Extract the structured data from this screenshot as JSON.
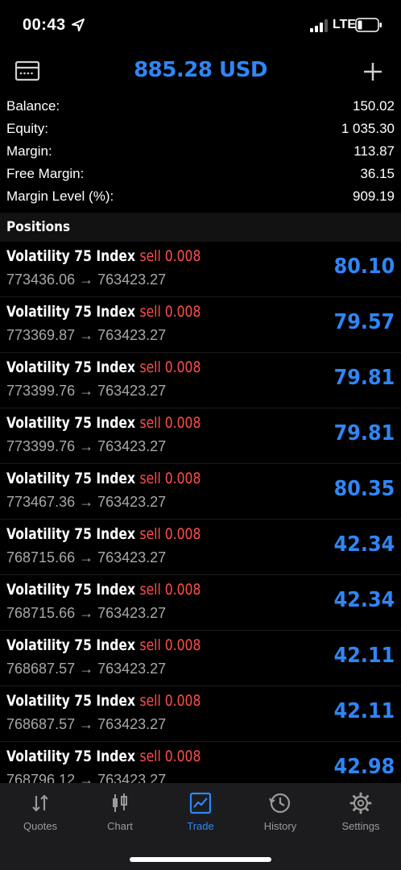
{
  "status": {
    "time": "00:43",
    "network": "LTE"
  },
  "header": {
    "title": "885.28 USD",
    "left_icon": "card-icon",
    "right_icon": "plus-icon"
  },
  "summary": [
    {
      "label": "Balance:",
      "value": "150.02"
    },
    {
      "label": "Equity:",
      "value": "1 035.30"
    },
    {
      "label": "Margin:",
      "value": "113.87"
    },
    {
      "label": "Free Margin:",
      "value": "36.15"
    },
    {
      "label": "Margin Level (%):",
      "value": "909.19"
    }
  ],
  "positions_title": "Positions",
  "positions": [
    {
      "symbol": "Volatility 75 Index",
      "side": "sell 0.008",
      "prices": "773436.06 → 763423.27",
      "profit": "80.10"
    },
    {
      "symbol": "Volatility 75 Index",
      "side": "sell 0.008",
      "prices": "773369.87 → 763423.27",
      "profit": "79.57"
    },
    {
      "symbol": "Volatility 75 Index",
      "side": "sell 0.008",
      "prices": "773399.76 → 763423.27",
      "profit": "79.81"
    },
    {
      "symbol": "Volatility 75 Index",
      "side": "sell 0.008",
      "prices": "773399.76 → 763423.27",
      "profit": "79.81"
    },
    {
      "symbol": "Volatility 75 Index",
      "side": "sell 0.008",
      "prices": "773467.36 → 763423.27",
      "profit": "80.35"
    },
    {
      "symbol": "Volatility 75 Index",
      "side": "sell 0.008",
      "prices": "768715.66 → 763423.27",
      "profit": "42.34"
    },
    {
      "symbol": "Volatility 75 Index",
      "side": "sell 0.008",
      "prices": "768715.66 → 763423.27",
      "profit": "42.34"
    },
    {
      "symbol": "Volatility 75 Index",
      "side": "sell 0.008",
      "prices": "768687.57 → 763423.27",
      "profit": "42.11"
    },
    {
      "symbol": "Volatility 75 Index",
      "side": "sell 0.008",
      "prices": "768687.57 → 763423.27",
      "profit": "42.11"
    },
    {
      "symbol": "Volatility 75 Index",
      "side": "sell 0.008",
      "prices": "768796.12 → 763423.27",
      "profit": "42.98"
    }
  ],
  "tabs": [
    {
      "label": "Quotes",
      "icon": "quotes-icon",
      "active": false
    },
    {
      "label": "Chart",
      "icon": "candlestick-icon",
      "active": false
    },
    {
      "label": "Trade",
      "icon": "trade-chart-icon",
      "active": true
    },
    {
      "label": "History",
      "icon": "history-icon",
      "active": false
    },
    {
      "label": "Settings",
      "icon": "gear-icon",
      "active": false
    }
  ],
  "colors": {
    "accent": "#2f86f6",
    "sell": "#ff4d4d",
    "muted": "#a8a8a8",
    "tabbar": "#1c1c1e"
  }
}
